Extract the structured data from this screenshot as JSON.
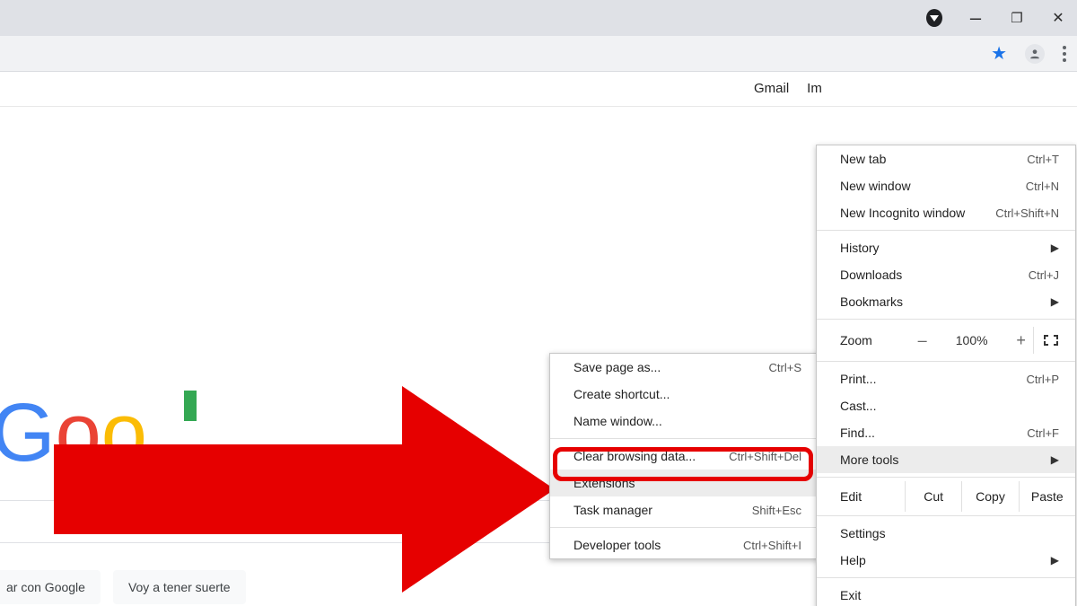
{
  "titlebar": {
    "minimize": "–",
    "maximize": "❐",
    "close": "✕"
  },
  "toolbar": {},
  "page": {
    "links": {
      "gmail": "Gmail",
      "images_partial": "Im"
    },
    "search": {
      "btn_search": "ar con Google",
      "btn_lucky": "Voy a tener suerte"
    }
  },
  "chrome_menu": {
    "new_tab": {
      "label": "New tab",
      "shortcut": "Ctrl+T"
    },
    "new_window": {
      "label": "New window",
      "shortcut": "Ctrl+N"
    },
    "new_incognito": {
      "label": "New Incognito window",
      "shortcut": "Ctrl+Shift+N"
    },
    "history": {
      "label": "History"
    },
    "downloads": {
      "label": "Downloads",
      "shortcut": "Ctrl+J"
    },
    "bookmarks": {
      "label": "Bookmarks"
    },
    "zoom": {
      "label": "Zoom",
      "minus": "–",
      "value": "100%",
      "plus": "+"
    },
    "print": {
      "label": "Print...",
      "shortcut": "Ctrl+P"
    },
    "cast": {
      "label": "Cast..."
    },
    "find": {
      "label": "Find...",
      "shortcut": "Ctrl+F"
    },
    "more_tools": {
      "label": "More tools"
    },
    "edit": {
      "label": "Edit",
      "cut": "Cut",
      "copy": "Copy",
      "paste": "Paste"
    },
    "settings": {
      "label": "Settings"
    },
    "help": {
      "label": "Help"
    },
    "exit": {
      "label": "Exit"
    }
  },
  "more_tools_menu": {
    "save_page": {
      "label": "Save page as...",
      "shortcut": "Ctrl+S"
    },
    "create_shortcut": {
      "label": "Create shortcut..."
    },
    "name_window": {
      "label": "Name window..."
    },
    "clear_data": {
      "label": "Clear browsing data...",
      "shortcut": "Ctrl+Shift+Del"
    },
    "extensions": {
      "label": "Extensions"
    },
    "task_manager": {
      "label": "Task manager",
      "shortcut": "Shift+Esc"
    },
    "developer_tools": {
      "label": "Developer tools",
      "shortcut": "Ctrl+Shift+I"
    }
  }
}
